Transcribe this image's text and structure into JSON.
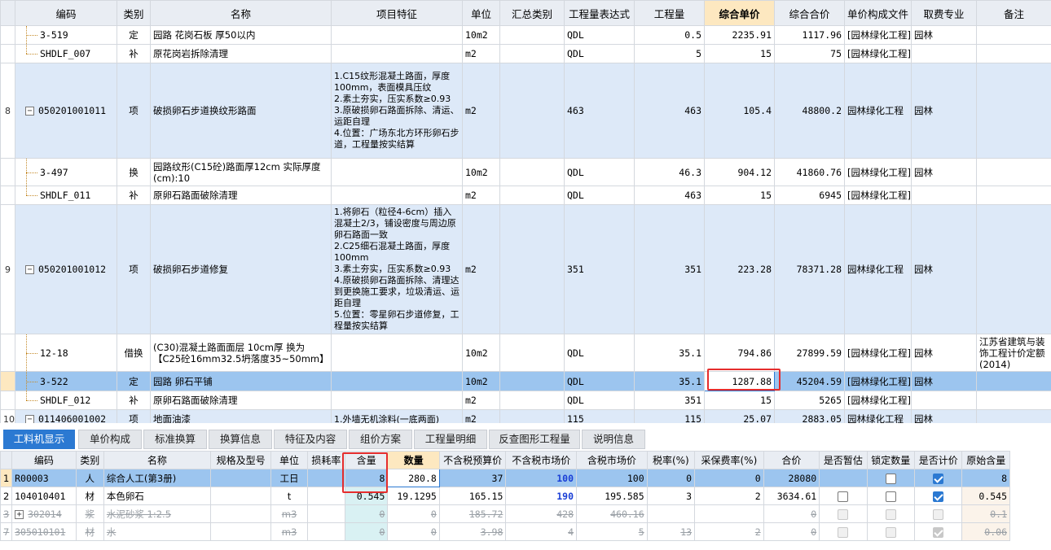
{
  "main_table": {
    "headers": {
      "code": "编码",
      "category": "类别",
      "name": "名称",
      "feature": "项目特征",
      "unit": "单位",
      "summary_cat": "汇总类别",
      "expr": "工程量表达式",
      "qty": "工程量",
      "unit_price": "综合单价",
      "total_price": "综合合价",
      "price_file": "单价构成文件",
      "fee_major": "取费专业",
      "remark": "备注"
    },
    "rows": [
      {
        "rownum": "",
        "code": "3-519",
        "category": "定",
        "name": "园路 花岗石板 厚50以内",
        "feature": "",
        "unit": "10m2",
        "summary_cat": "",
        "expr": "QDL",
        "qty": "0.5",
        "unit_price": "2235.91",
        "total_price": "1117.96",
        "price_file": "[园林绿化工程]",
        "fee_major": "园林",
        "remark": ""
      },
      {
        "rownum": "",
        "code": "SHDLF_007",
        "category": "补",
        "name": "原花岗岩拆除清理",
        "feature": "",
        "unit": "m2",
        "summary_cat": "",
        "expr": "QDL",
        "qty": "5",
        "unit_price": "15",
        "total_price": "75",
        "price_file": "[园林绿化工程]",
        "fee_major": "",
        "remark": ""
      },
      {
        "rownum": "8",
        "code": "050201001011",
        "category": "项",
        "name": "破损卵石步道换纹形路面",
        "feature": "1.C15纹形混凝土路面，厚度100mm，表面模具压纹\n2.素土夯实，压实系数≥0.93\n3.原破损卵石路面拆除、清运、运距自理\n4.位置：广场东北方环形卵石步道，工程量按实结算",
        "unit": "m2",
        "summary_cat": "",
        "expr": "463",
        "qty": "463",
        "unit_price": "105.4",
        "total_price": "48800.2",
        "price_file": "园林绿化工程",
        "fee_major": "园林",
        "remark": ""
      },
      {
        "rownum": "",
        "code": "3-497",
        "category": "换",
        "name": "园路纹形(C15砼)路面厚12cm  实际厚度(cm):10",
        "feature": "",
        "unit": "10m2",
        "summary_cat": "",
        "expr": "QDL",
        "qty": "46.3",
        "unit_price": "904.12",
        "total_price": "41860.76",
        "price_file": "[园林绿化工程]",
        "fee_major": "园林",
        "remark": ""
      },
      {
        "rownum": "",
        "code": "SHDLF_011",
        "category": "补",
        "name": "原卵石路面破除清理",
        "feature": "",
        "unit": "m2",
        "summary_cat": "",
        "expr": "QDL",
        "qty": "463",
        "unit_price": "15",
        "total_price": "6945",
        "price_file": "[园林绿化工程]",
        "fee_major": "",
        "remark": ""
      },
      {
        "rownum": "9",
        "code": "050201001012",
        "category": "项",
        "name": "破损卵石步道修复",
        "feature": "1.将卵石（粒径4-6cm）插入混凝土2/3，铺设密度与周边原卵石路面一致\n2.C25细石混凝土路面，厚度100mm\n3.素土夯实，压实系数≥0.93\n4.原破损卵石路面拆除、清理达到更换施工要求，垃圾清运、运距自理\n5.位置：零星卵石步道修复，工程量按实结算",
        "unit": "m2",
        "summary_cat": "",
        "expr": "351",
        "qty": "351",
        "unit_price": "223.28",
        "total_price": "78371.28",
        "price_file": "园林绿化工程",
        "fee_major": "园林",
        "remark": ""
      },
      {
        "rownum": "",
        "code": "12-18",
        "category": "借换",
        "name": "(C30)混凝土路面面层 10cm厚  换为【C25砼16mm32.5坍落度35~50mm】",
        "feature": "",
        "unit": "10m2",
        "summary_cat": "",
        "expr": "QDL",
        "qty": "35.1",
        "unit_price": "794.86",
        "total_price": "27899.59",
        "price_file": "[园林绿化工程]",
        "fee_major": "园林",
        "remark": "江苏省建筑与装饰工程计价定额(2014)"
      },
      {
        "rownum": "",
        "code": "3-522",
        "category": "定",
        "name": "园路 卵石平铺",
        "feature": "",
        "unit": "10m2",
        "summary_cat": "",
        "expr": "QDL",
        "qty": "35.1",
        "unit_price": "1287.88",
        "total_price": "45204.59",
        "price_file": "[园林绿化工程]",
        "fee_major": "园林",
        "remark": ""
      },
      {
        "rownum": "",
        "code": "SHDLF_012",
        "category": "补",
        "name": "原卵石路面破除清理",
        "feature": "",
        "unit": "m2",
        "summary_cat": "",
        "expr": "QDL",
        "qty": "351",
        "unit_price": "15",
        "total_price": "5265",
        "price_file": "[园林绿化工程]",
        "fee_major": "",
        "remark": ""
      },
      {
        "rownum": "10",
        "code": "011406001002",
        "category": "项",
        "name": "地面油漆",
        "feature": "1.外墙无机涂料(一底两面)",
        "unit": "m2",
        "summary_cat": "",
        "expr": "115",
        "qty": "115",
        "unit_price": "25.07",
        "total_price": "2883.05",
        "price_file": "园林绿化工程",
        "fee_major": "园林",
        "remark": ""
      }
    ]
  },
  "tabs": [
    "工料机显示",
    "单价构成",
    "标准换算",
    "换算信息",
    "特征及内容",
    "组价方案",
    "工程量明细",
    "反查图形工程量",
    "说明信息"
  ],
  "sub_table": {
    "headers": {
      "code": "编码",
      "category": "类别",
      "name": "名称",
      "spec": "规格及型号",
      "unit": "单位",
      "loss": "损耗率",
      "content": "含量",
      "quantity": "数量",
      "budget_ex": "不含税预算价",
      "market_ex": "不含税市场价",
      "market_in": "含税市场价",
      "tax": "税率(%)",
      "purchase": "采保费率(%)",
      "total": "合价",
      "est": "是否暂估",
      "lock": "锁定数量",
      "priced": "是否计价",
      "orig": "原始含量"
    },
    "rows": [
      {
        "rownum": "1",
        "code": "R00003",
        "category": "人",
        "name": "综合人工(第3册)",
        "spec": "",
        "unit": "工日",
        "loss": "",
        "content": "8",
        "quantity": "280.8",
        "budget_ex": "37",
        "market_ex": "100",
        "market_in": "100",
        "tax": "0",
        "purchase": "0",
        "total": "28080",
        "orig": "8"
      },
      {
        "rownum": "2",
        "code": "104010401",
        "category": "材",
        "name": "本色卵石",
        "spec": "",
        "unit": "t",
        "loss": "",
        "content": "0.545",
        "quantity": "19.1295",
        "budget_ex": "165.15",
        "market_ex": "190",
        "market_in": "195.585",
        "tax": "3",
        "purchase": "2",
        "total": "3634.61",
        "orig": "0.545"
      },
      {
        "rownum": "3",
        "code": "302014",
        "category": "浆",
        "name": "水泥砂浆 1:2.5",
        "spec": "",
        "unit": "m3",
        "loss": "",
        "content": "0",
        "quantity": "0",
        "budget_ex": "185.72",
        "market_ex": "428",
        "market_in": "460.16",
        "tax": "",
        "purchase": "",
        "total": "0",
        "orig": "0.1"
      },
      {
        "rownum": "7",
        "code": "305010101",
        "category": "材",
        "name": "水",
        "spec": "",
        "unit": "m3",
        "loss": "",
        "content": "0",
        "quantity": "0",
        "budget_ex": "3.98",
        "market_ex": "4",
        "market_in": "5",
        "tax": "13",
        "purchase": "2",
        "total": "0",
        "orig": "0.06"
      }
    ]
  }
}
